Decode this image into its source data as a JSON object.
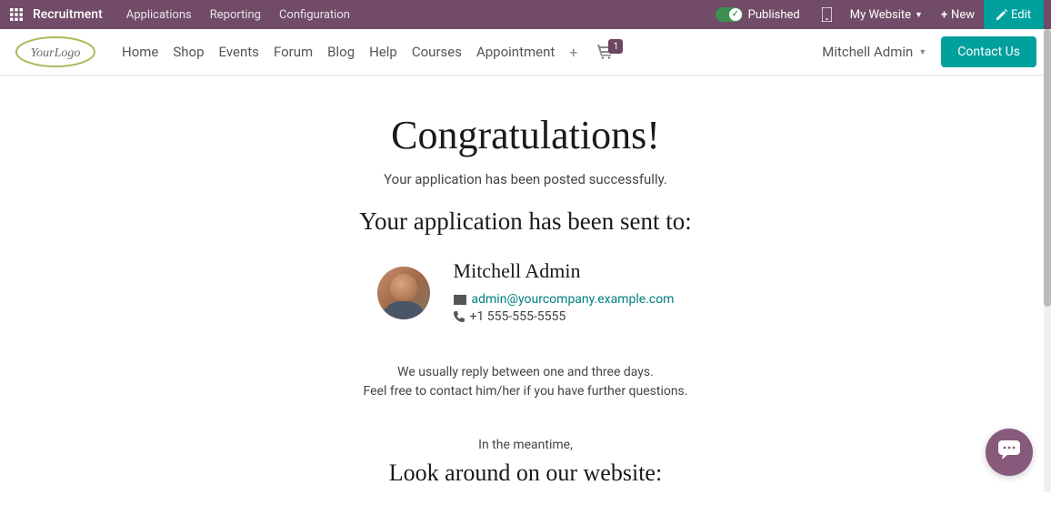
{
  "admin_bar": {
    "title": "Recruitment",
    "nav": [
      "Applications",
      "Reporting",
      "Configuration"
    ],
    "published_label": "Published",
    "website_label": "My Website",
    "new_label": "New",
    "edit_label": "Edit"
  },
  "header": {
    "logo_text": "YourLogo",
    "nav": [
      "Home",
      "Shop",
      "Events",
      "Forum",
      "Blog",
      "Help",
      "Courses",
      "Appointment"
    ],
    "cart_count": "1",
    "user_name": "Mitchell Admin",
    "contact_btn": "Contact Us"
  },
  "content": {
    "title": "Congratulations!",
    "posted_msg": "Your application has been posted successfully.",
    "sent_to_heading": "Your application has been sent to:",
    "contact_name": "Mitchell Admin",
    "contact_email": "admin@yourcompany.example.com",
    "contact_phone": "+1 555-555-5555",
    "reply_info_line1": "We usually reply between one and three days.",
    "reply_info_line2": "Feel free to contact him/her if you have further questions.",
    "meantime": "In the meantime,",
    "look_around": "Look around on our website:"
  },
  "colors": {
    "admin_bg": "#714b67",
    "teal": "#00a09d",
    "chat_purple": "#875a7b"
  }
}
